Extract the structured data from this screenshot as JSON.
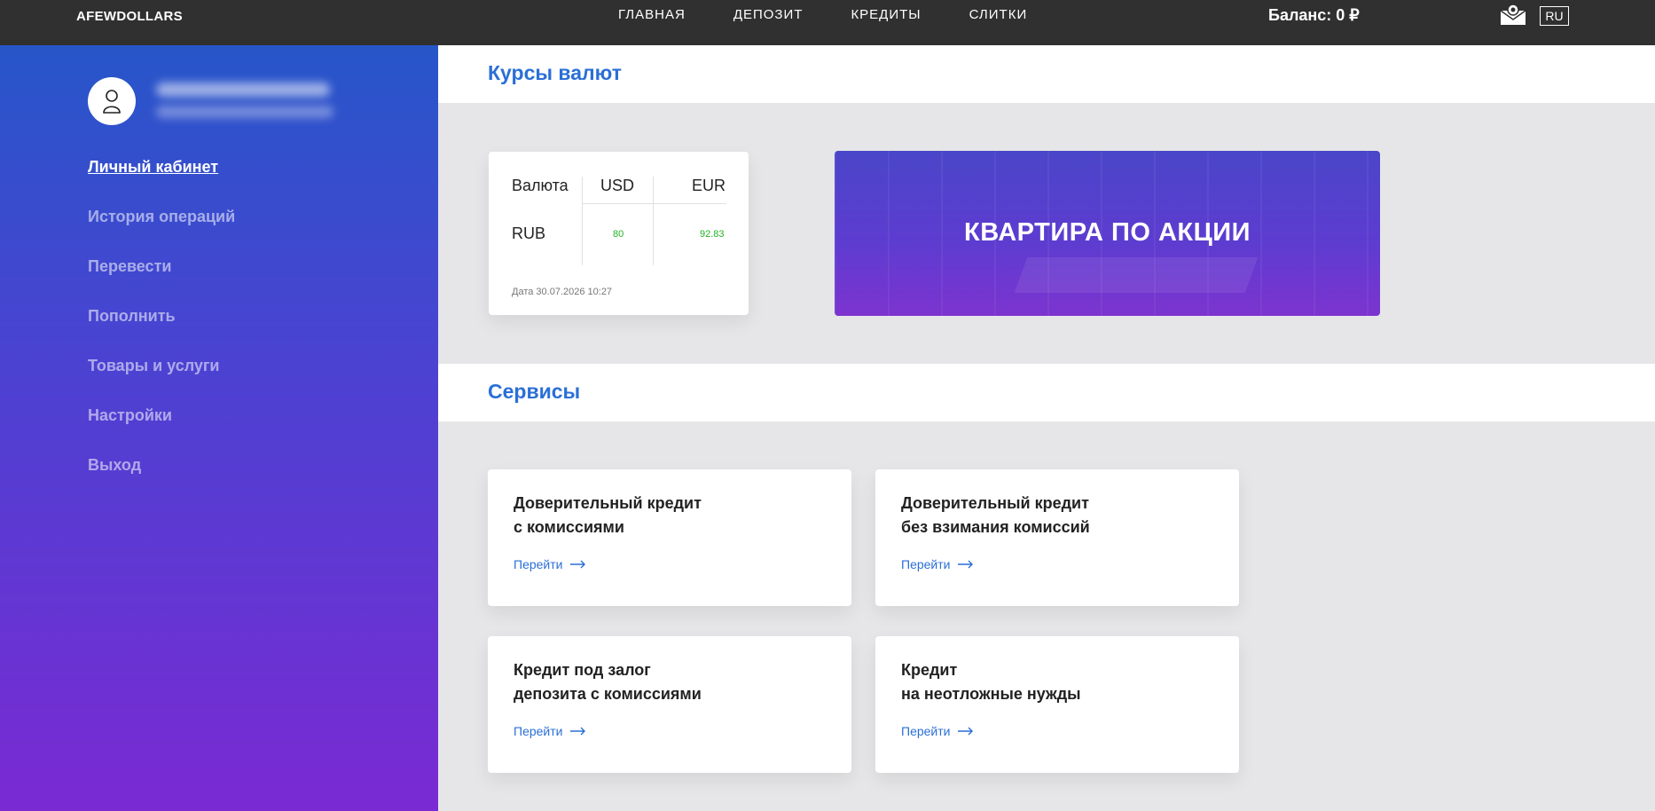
{
  "header": {
    "brand": "AFEWDOLLARS",
    "nav": [
      "ГЛАВНАЯ",
      "ДЕПОЗИТ",
      "КРЕДИТЫ",
      "СЛИТКИ"
    ],
    "balance": "Баланс: 0 ₽",
    "language": "RU",
    "mail_icon": "mail-settings-icon"
  },
  "sidebar": {
    "avatar_icon": "user-icon",
    "items": [
      {
        "label": "Личный кабинет"
      },
      {
        "label": "История операций"
      },
      {
        "label": "Перевести"
      },
      {
        "label": "Пополнить"
      },
      {
        "label": "Товары и услуги"
      },
      {
        "label": "Настройки"
      },
      {
        "label": "Выход"
      }
    ]
  },
  "rates_section": {
    "title": "Курсы валют",
    "table": {
      "headers": [
        "Валюта",
        "USD",
        "EUR"
      ],
      "rows": [
        {
          "currency": "RUB",
          "usd": "80",
          "eur": "92.83"
        }
      ],
      "date": "Дата 30.07.2026 10:27"
    },
    "promo": {
      "title": "КВАРТИРА ПО АКЦИИ"
    }
  },
  "services_section": {
    "title": "Сервисы",
    "cards": [
      {
        "line1": "Доверительный кредит",
        "line2": "с комиссиями",
        "link": "Перейти"
      },
      {
        "line1": "Доверительный кредит",
        "line2": "без взимания комиссий",
        "link": "Перейти"
      },
      {
        "line1": "Кредит под залог",
        "line2": "депозита с комиссиями",
        "link": "Перейти"
      },
      {
        "line1": "Кредит",
        "line2": "на неотложные нужды",
        "link": "Перейти"
      }
    ]
  },
  "colors": {
    "topbar": "#303030",
    "accent": "#2a6fd6",
    "rate_value": "#22b222"
  }
}
